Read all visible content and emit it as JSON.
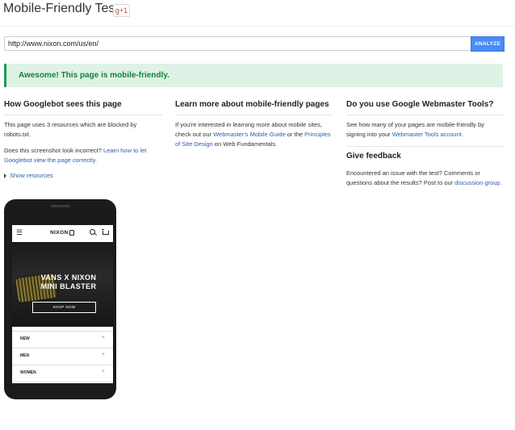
{
  "header": {
    "title": "Mobile-Friendly Test",
    "gplus_label": "g+1"
  },
  "form": {
    "url_value": "http://www.nixon.com/us/en/",
    "analyze_label": "ANALYZE"
  },
  "result": {
    "text": "Awesome! This page is mobile-friendly."
  },
  "col1": {
    "heading": "How Googlebot sees this page",
    "p1": "This page uses 3 resources which are blocked by robots.txt.",
    "p2_text": "Does this screenshot look incorrect? ",
    "p2_link": "Learn how to let Googlebot view the page correctly.",
    "show_resources": "Show resources"
  },
  "col2": {
    "heading": "Learn more about mobile-friendly pages",
    "p_pre": "If you're interested in learning more about mobile sites, check out our ",
    "link1": "Webmaster's Mobile Guide",
    "p_mid": " or the ",
    "link2": "Principles of Site Design",
    "p_post": " on Web Fundamentals."
  },
  "col3": {
    "heading": "Do you use Google Webmaster Tools?",
    "p_pre": "See how many of your pages are mobile-friendly by signing into your ",
    "link": "Webmaster Tools account.",
    "feedback_heading": "Give feedback",
    "fb_pre": "Encountered an issue with the test? Comments or questions about the results? Post to our ",
    "fb_link": "discussion group."
  },
  "phone": {
    "logo": "NIXON",
    "hero_line1": "VANS X NIXON",
    "hero_line2": "MINI BLASTER",
    "shop_label": "SHOP NOW",
    "menu": [
      {
        "label": "NEW"
      },
      {
        "label": "MEN"
      },
      {
        "label": "WOMEN"
      }
    ],
    "plus": "+"
  },
  "colors": {
    "accent_button": "#4a8af4",
    "success_bg": "#dff2e6",
    "success_text": "#188038",
    "link": "#2a5db0"
  }
}
